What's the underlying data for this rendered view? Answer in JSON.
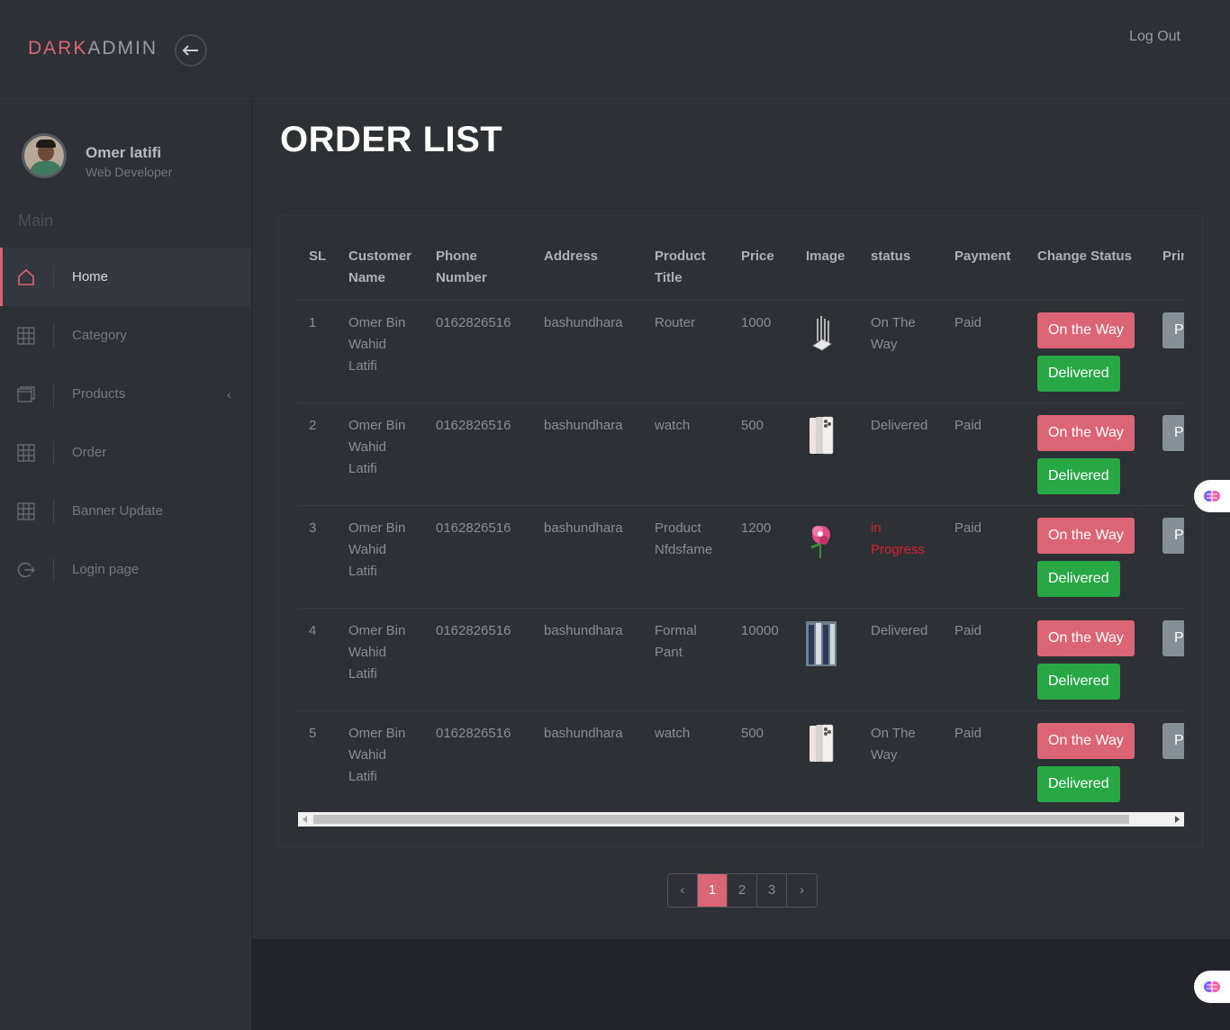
{
  "brand": {
    "part1": "DARK",
    "part2": "ADMIN"
  },
  "header": {
    "logout_label": "Log Out"
  },
  "profile": {
    "name": "Omer latifi",
    "role": "Web Developer"
  },
  "sidebar": {
    "section_label": "Main",
    "items": [
      {
        "label": "Home",
        "icon": "home-icon",
        "active": true
      },
      {
        "label": "Category",
        "icon": "grid-icon"
      },
      {
        "label": "Products",
        "icon": "window-icon"
      },
      {
        "label": "Order",
        "icon": "grid-icon"
      },
      {
        "label": "Banner Update",
        "icon": "grid-icon"
      },
      {
        "label": "Login page",
        "icon": "logout-icon"
      }
    ],
    "products_chevron": "‹"
  },
  "main": {
    "title": "ORDER LIST",
    "table": {
      "headers": [
        "SL",
        "Customer Name",
        "Phone Number",
        "Address",
        "Product Title",
        "Price",
        "Image",
        "status",
        "Payment",
        "Change Status",
        "Print"
      ],
      "rows": [
        {
          "sl": "1",
          "customer": "Omer Bin Wahid Latifi",
          "phone": "0162826516",
          "address": "bashundhara",
          "product": "Router",
          "price": "1000",
          "image": "router-image",
          "status": "On The Way",
          "payment": "Paid"
        },
        {
          "sl": "2",
          "customer": "Omer Bin Wahid Latifi",
          "phone": "0162826516",
          "address": "bashundhara",
          "product": "watch",
          "price": "500",
          "image": "phone-image",
          "status": "Delivered",
          "payment": "Paid"
        },
        {
          "sl": "3",
          "customer": "Omer Bin Wahid Latifi",
          "phone": "0162826516",
          "address": "bashundhara",
          "product": "Product Nfdsfame",
          "price": "1200",
          "image": "flower-image",
          "status": "in Progress",
          "payment": "Paid"
        },
        {
          "sl": "4",
          "customer": "Omer Bin Wahid Latifi",
          "phone": "0162826516",
          "address": "bashundhara",
          "product": "Formal Pant",
          "price": "10000",
          "image": "pants-image",
          "status": "Delivered",
          "payment": "Paid"
        },
        {
          "sl": "5",
          "customer": "Omer Bin Wahid Latifi",
          "phone": "0162826516",
          "address": "bashundhara",
          "product": "watch",
          "price": "500",
          "image": "phone-image",
          "status": "On The Way",
          "payment": "Paid"
        }
      ],
      "on_the_way_label": "On the Way",
      "delivered_label": "Delivered",
      "print_label": "Print"
    },
    "pagination": {
      "prev": "‹",
      "pages": [
        "1",
        "2",
        "3"
      ],
      "active": "1",
      "next": "›"
    }
  },
  "colors": {
    "accent": "#db6574",
    "success": "#28a745",
    "danger_text": "#dc1f2f",
    "bg": "#2d3035"
  }
}
